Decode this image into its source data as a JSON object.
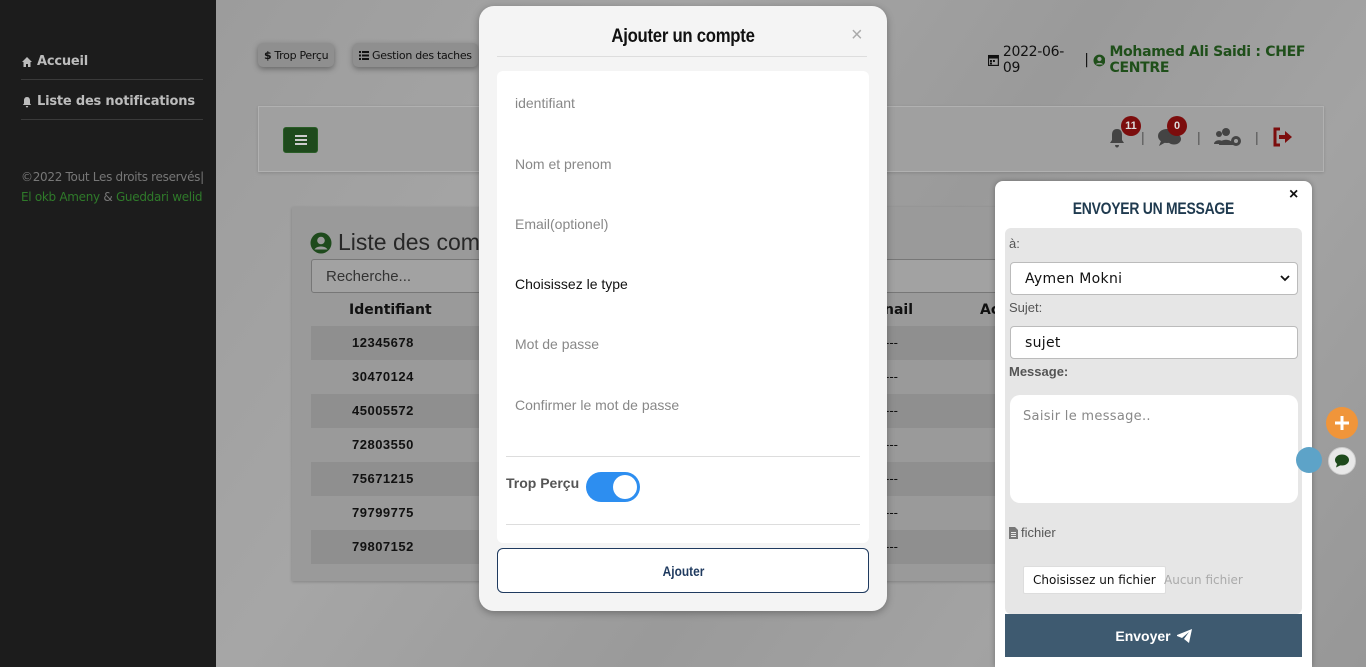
{
  "sidebar": {
    "items": [
      {
        "label": "Accueil",
        "icon": "home-icon"
      },
      {
        "label": "Liste des notifications",
        "icon": "bell-icon"
      }
    ],
    "copyright": "©2022 Tout Les droits reservés|",
    "author1": "El okb Ameny",
    "separator": "&",
    "author2": "Gueddari welid"
  },
  "topbar": {
    "chip1": "Trop Perçu",
    "chip1_icon": "$",
    "chip2": "Gestion des taches",
    "date": "2022-06-09",
    "separator": "|",
    "user": "Mohamed Ali Saidi : CHEF CENTRE"
  },
  "header": {
    "notifications_count": "11",
    "messages_count": "0",
    "pipe": "|"
  },
  "list": {
    "title": "Liste des com",
    "search_placeholder": "Recherche...",
    "columns": [
      "Identifiant",
      "nail",
      "Ac"
    ],
    "rows": [
      {
        "id": "12345678",
        "email": "---"
      },
      {
        "id": "30470124",
        "email": "---"
      },
      {
        "id": "45005572",
        "email": "---"
      },
      {
        "id": "72803550",
        "email": "---"
      },
      {
        "id": "75671215",
        "email": "---"
      },
      {
        "id": "79799775",
        "email": "---"
      },
      {
        "id": "79807152",
        "email": "---"
      }
    ]
  },
  "modal": {
    "title": "Ajouter un compte",
    "close": "×",
    "fields": {
      "identifiant": "identifiant",
      "nom": "Nom et prenom",
      "email": "Email(optionel)",
      "type": "Choisissez le type",
      "password": "Mot de passe",
      "confirm": "Confirmer le mot de passe"
    },
    "toggle_label": "Trop Perçu",
    "toggle_on": true,
    "submit": "Ajouter"
  },
  "message_panel": {
    "title": "ENVOYER UN MESSAGE",
    "close": "×",
    "to_label": "à:",
    "to_value": "Aymen Mokni",
    "subject_label": "Sujet:",
    "subject_value": "sujet",
    "message_label": "Message:",
    "message_placeholder": "Saisir le message..",
    "file_label": "fichier",
    "file_button": "Choisissez un fichier",
    "file_none": "Aucun fichier",
    "send": "Envoyer"
  },
  "colors": {
    "sidebar_bg": "#1c1c1c",
    "brand_green": "#1e4a1c",
    "toggle_blue": "#2d8ef0",
    "send_btn": "#3e5a70",
    "fab_orange": "#f0953a"
  }
}
